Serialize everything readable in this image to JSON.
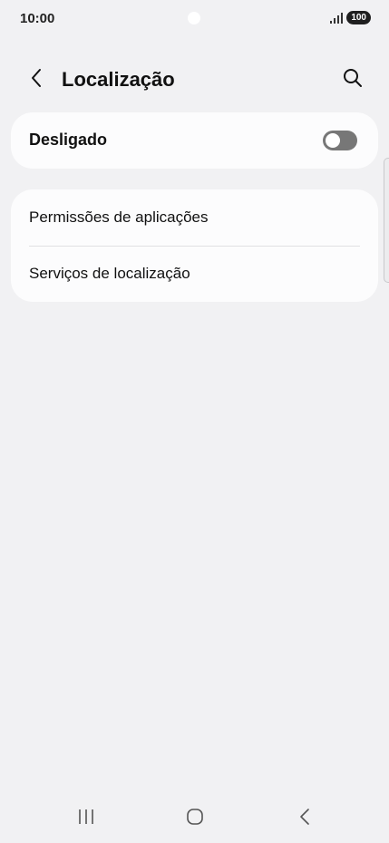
{
  "status_bar": {
    "time": "10:00",
    "battery": "100",
    "icons": [
      "signal-icon",
      "battery-icon"
    ]
  },
  "header": {
    "title": "Localização",
    "back_icon": "chevron-left-icon",
    "search_icon": "search-icon"
  },
  "location_toggle": {
    "label": "Desligado",
    "state": "off"
  },
  "settings_list": {
    "items": [
      {
        "label": "Permissões de aplicações"
      },
      {
        "label": "Serviços de localização"
      }
    ]
  },
  "nav_bar": {
    "icons": [
      "recent-apps-icon",
      "home-icon",
      "back-icon"
    ]
  },
  "colors": {
    "background": "#f1f1f3",
    "card": "#fcfcfd",
    "switch_off": "#777777",
    "text": "#111111"
  }
}
